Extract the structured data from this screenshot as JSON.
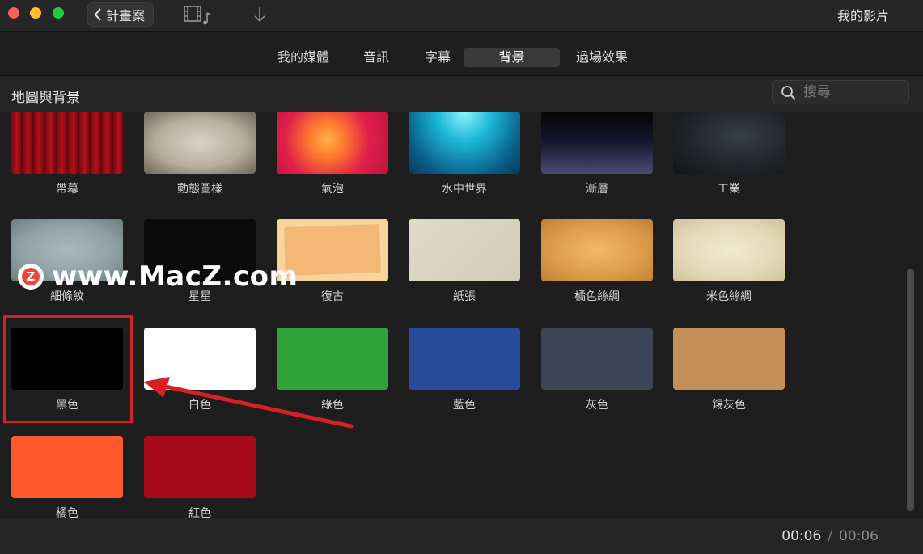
{
  "titlebar": {
    "back_label": "計畫案",
    "window_title": "我的影片"
  },
  "tabs": [
    {
      "label": "我的媒體",
      "active": false
    },
    {
      "label": "音訊",
      "active": false
    },
    {
      "label": "字幕",
      "active": false
    },
    {
      "label": "背景",
      "active": true
    },
    {
      "label": "過場效果",
      "active": false
    }
  ],
  "section": {
    "title": "地圖與背景",
    "search_placeholder": "搜尋"
  },
  "backgrounds": [
    {
      "label": "帶幕",
      "style": "curtain"
    },
    {
      "label": "動態圖樣",
      "style": "parchment"
    },
    {
      "label": "氣泡",
      "style": "bubbles"
    },
    {
      "label": "水中世界",
      "style": "underwater"
    },
    {
      "label": "漸層",
      "style": "gradient"
    },
    {
      "label": "工業",
      "style": "industrial"
    },
    {
      "label": "細條紋",
      "style": "pinstripe"
    },
    {
      "label": "星星",
      "style": "stars"
    },
    {
      "label": "復古",
      "style": "retro"
    },
    {
      "label": "紙張",
      "style": "paper"
    },
    {
      "label": "橘色絲綢",
      "style": "orange-silk"
    },
    {
      "label": "米色絲綢",
      "style": "beige-silk"
    },
    {
      "label": "黑色",
      "color": "#000000"
    },
    {
      "label": "白色",
      "color": "#ffffff"
    },
    {
      "label": "綠色",
      "color": "#2fa23a"
    },
    {
      "label": "藍色",
      "color": "#264c9a"
    },
    {
      "label": "灰色",
      "color": "#3c4658"
    },
    {
      "label": "錫灰色",
      "color": "#c48e57"
    },
    {
      "label": "橘色",
      "color": "#ff5a2c"
    },
    {
      "label": "紅色",
      "color": "#a50a1a"
    }
  ],
  "timecode": {
    "current": "00:06",
    "separator": "/",
    "total": "00:06"
  },
  "watermark": {
    "logo_letter": "Z",
    "text": "www.MacZ.com"
  }
}
